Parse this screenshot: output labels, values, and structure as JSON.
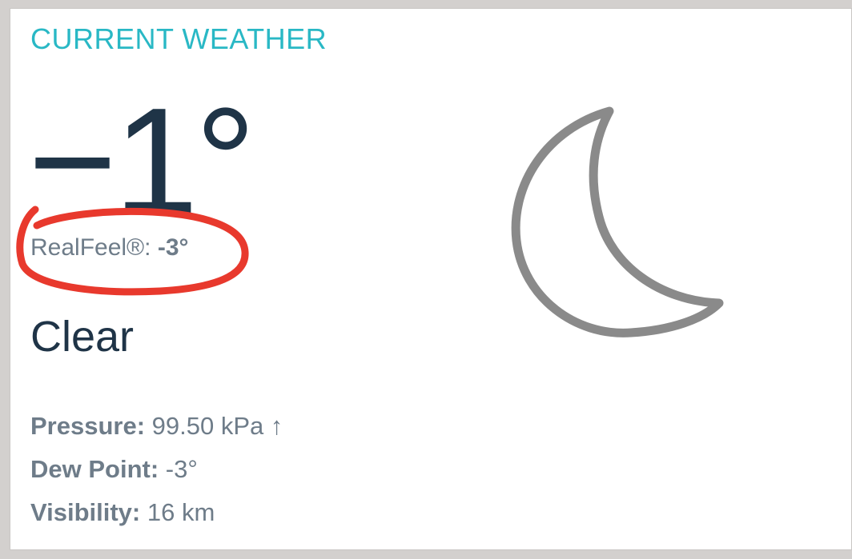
{
  "card": {
    "title": "CURRENT WEATHER",
    "temperature": "−1°",
    "realfeel_label": "RealFeel®:",
    "realfeel_value": "-3°",
    "condition": "Clear",
    "icon": "moon-icon"
  },
  "details": [
    {
      "label": "Pressure:",
      "value": "99.50 kPa ↑"
    },
    {
      "label": "Dew Point:",
      "value": "-3°"
    },
    {
      "label": "Visibility:",
      "value": "16 km"
    }
  ],
  "colors": {
    "title_accent": "#29b8c5",
    "temperature_text": "#1f3447",
    "secondary_text": "#6e7c89",
    "annotation_circle": "#e8392d",
    "moon_stroke": "#8a8a8a"
  }
}
